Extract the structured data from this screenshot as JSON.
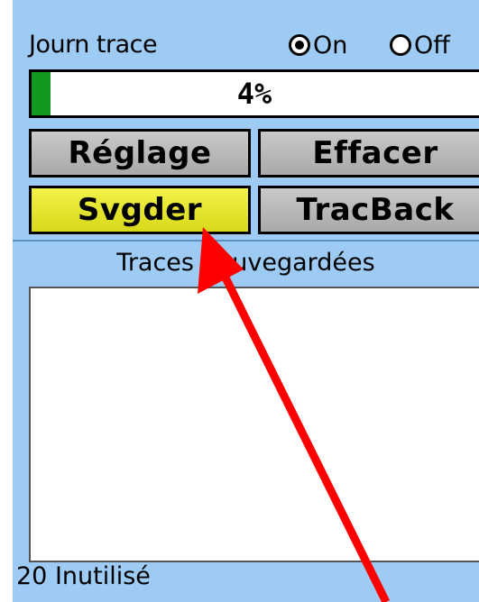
{
  "track_log": {
    "label": "Journ trace",
    "options": [
      {
        "label": "On",
        "selected": true
      },
      {
        "label": "Off",
        "selected": false
      }
    ],
    "progress_text": "4%",
    "progress_value_percent": 4
  },
  "buttons": {
    "setup": "Réglage",
    "clear": "Effacer",
    "save": "Svgder",
    "trackback": "TracBack"
  },
  "saved_tracks": {
    "title": "Traces Sauvegardées",
    "items": [],
    "footer": "20 Inutilisé"
  },
  "colors": {
    "screen_bg": "#9dcbf4",
    "progress_fill": "#119a1d",
    "selected_button": "#eeee3a",
    "annotation_arrow": "#ff0000"
  }
}
